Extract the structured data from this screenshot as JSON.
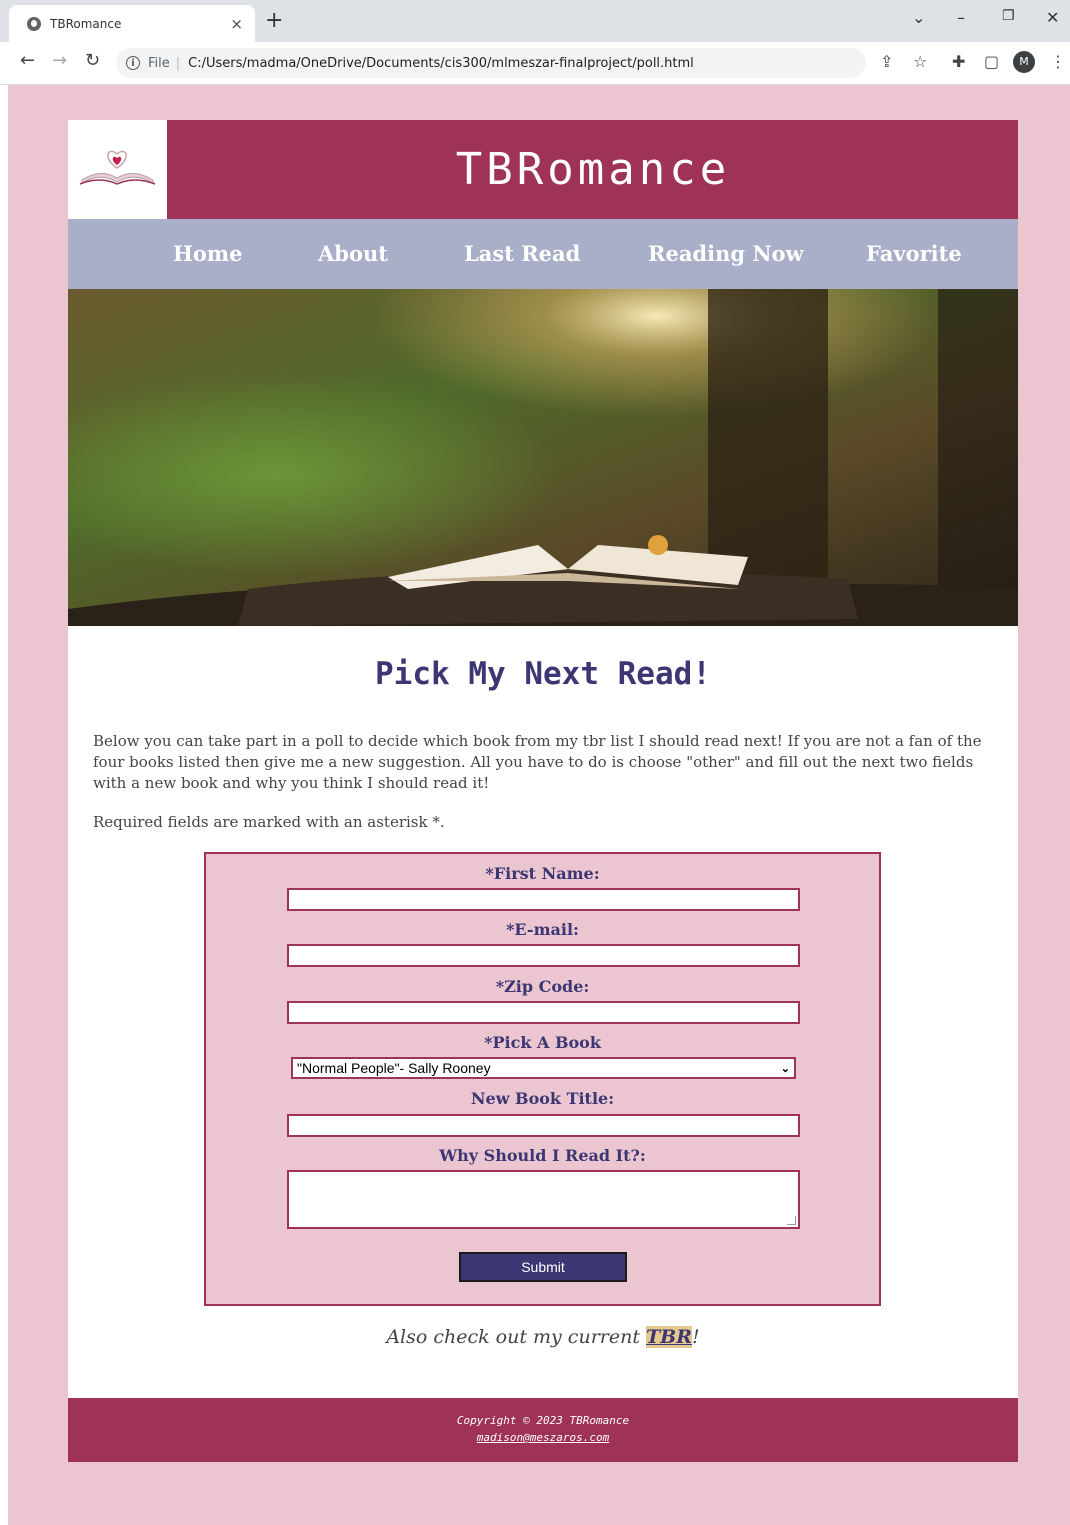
{
  "browser": {
    "tab_title": "TBRomance",
    "tab_close": "×",
    "new_tab": "+",
    "url_scheme": "File",
    "url": "C:/Users/madma/OneDrive/Documents/cis300/mlmeszar-finalproject/poll.html",
    "profile_initial": "M"
  },
  "header": {
    "site_title": "TBRomance"
  },
  "nav": {
    "items": [
      "Home",
      "About",
      "Last Read",
      "Reading Now",
      "Favorite"
    ]
  },
  "poll": {
    "title": "Pick My Next Read!",
    "intro": "Below you can take part in a poll to decide which book from my tbr list I should read next! If you are not a fan of the four books listed then give me a new suggestion. All you have to do is choose \"other\" and fill out the next two fields with a new book and why you think I should read it!",
    "required_note": "Required fields are marked with an asterisk *."
  },
  "form": {
    "first_name_label": "*First Name:",
    "email_label": "*E-mail:",
    "zip_label": "*Zip Code:",
    "book_label": "*Pick A Book",
    "book_selected": "\"Normal People\"- Sally Rooney",
    "new_title_label": "New Book Title:",
    "why_label": "Why Should I Read It?:",
    "submit_label": "Submit"
  },
  "tbr": {
    "prefix": "Also check out my current ",
    "link": "TBR",
    "suffix": "!"
  },
  "footer": {
    "copyright": "Copyright © 2023 TBRomance",
    "email": "madison@meszaros.com"
  },
  "colors": {
    "page_bg": "#ebc6d1",
    "header_bg": "#9e3355",
    "nav_bg": "#a9aec9",
    "heading_text": "#3c3673",
    "tbr_highlight": "#e6c98f"
  }
}
